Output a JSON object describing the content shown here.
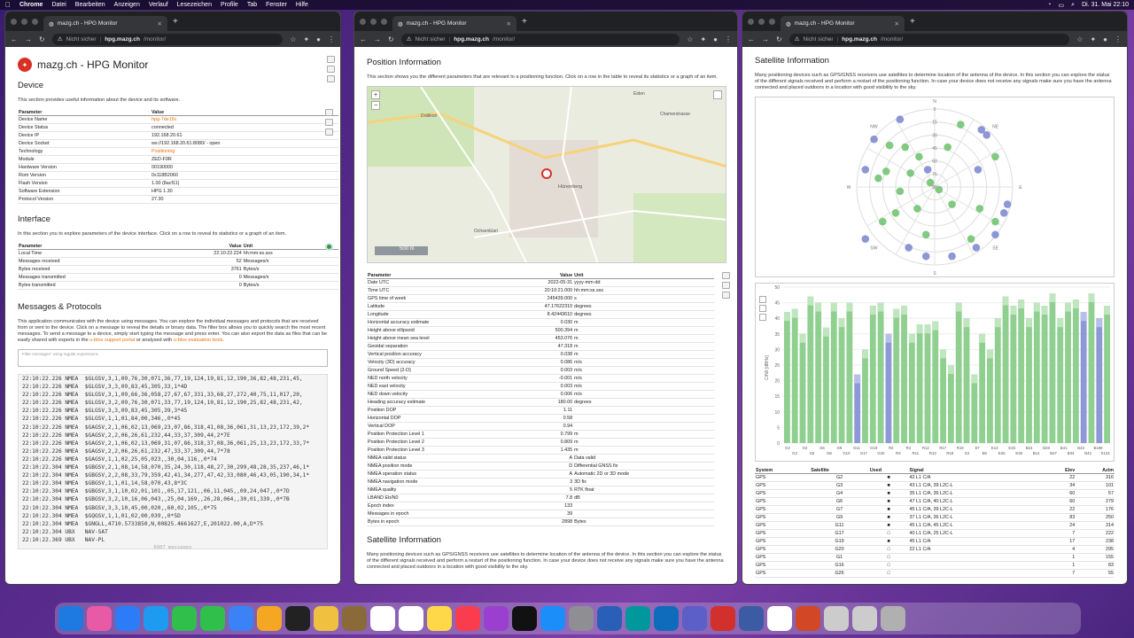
{
  "menubar": {
    "app": "Chrome",
    "items": [
      "Datei",
      "Bearbeiten",
      "Anzeigen",
      "Verlauf",
      "Lesezeichen",
      "Profile",
      "Tab",
      "Fenster",
      "Hilfe"
    ],
    "clock": "Di. 31. Mai  22:10"
  },
  "browser": {
    "tab_title": "mazg.ch - HPG Monitor",
    "not_secure": "Nicht sicher",
    "host": "hpg.mazg.ch",
    "path": "/monitor/"
  },
  "win1": {
    "title": "mazg.ch - HPG Monitor",
    "device_heading": "Device",
    "device_desc": "This section provides useful information about the device and its software.",
    "device_headers": [
      "Parameter",
      "Value"
    ],
    "device_rows": [
      [
        "Device Name",
        "hpg-7de16c"
      ],
      [
        "Device Status",
        "connected"
      ],
      [
        "Device IP",
        "192.168.20.61"
      ],
      [
        "Device Socket",
        "ws://192.168.20.61:8080/ - open"
      ],
      [
        "Technology",
        "Positioning"
      ],
      [
        "Module",
        "ZED-F9R"
      ],
      [
        "Hardware Version",
        "00190000"
      ],
      [
        "Rom Version",
        "0x118B2060"
      ],
      [
        "Flash Version",
        "1.00 (8acf11)"
      ],
      [
        "Software Extension",
        "HPG 1.30"
      ],
      [
        "Protocol Version",
        "27.30"
      ]
    ],
    "interface_heading": "Interface",
    "interface_desc": "In this section you to explore parameters of the device interface. Click on a row to reveal its statistics or a graph of an item.",
    "interface_headers": [
      "Parameter",
      "Value",
      "Unit"
    ],
    "interface_rows": [
      [
        "Local Time",
        "22:10:22.224",
        "hh:mm:ss.sss"
      ],
      [
        "Messages received",
        "52",
        "Messages/s"
      ],
      [
        "Bytes received",
        "3761",
        "Bytes/s"
      ],
      [
        "Messages transmitted",
        "0",
        "Messages/s"
      ],
      [
        "Bytes transmitted",
        "0",
        "Bytes/s"
      ]
    ],
    "messages_heading": "Messages & Protocols",
    "messages_desc": "This application communicates with the device using messages. You can explore the individual messages and protocols that are received from or sent to the device. Click on a message to reveal the details or binary data. The filter box allows you to quickly search the most recent messages. To send a message to a device, simply start typing the message and press enter. You can also export the data as files that can be easily shared with experts in the",
    "messages_link1": "u-blox support portal",
    "messages_mid": "or analysed with",
    "messages_link2": "u-blox evaluation tools",
    "filter_placeholder": "Filter messages\" using regular expressions",
    "console_lines": [
      "22:10:22.226 NMEA  $GLGSV,3,1,09,76,30,071,36,77,19,124,19,81,12,190,36,82,48,231,45,",
      "22:10:22.226 NMEA  $GLGSV,3,3,09,83,45,305,33,1*4D",
      "22:10:22.226 NMEA  $GLGSV,3,1,09,66,36,058,27,67,67,331,33,68,27,272,40,75,11,017,20,",
      "22:10:22.226 NMEA  $GLGSV,3,2,09,76,30,071,33,77,19,124,10,81,12,190,25,82,48,231,42,",
      "22:10:22.226 NMEA  $GLGSV,3,3,09,83,45,305,39,3*45",
      "22:10:22.226 NMEA  $GLGSV,1,1,01,84,00,346,,0*45",
      "22:10:22.226 NMEA  $GAGSV,2,1,06,02,13,069,23,07,86,318,41,08,36,061,31,13,23,172,39,2*",
      "22:10:22.226 NMEA  $GAGSV,2,2,06,26,61,232,44,33,37,309,44,2*7E",
      "22:10:22.226 NMEA  $GAGSV,2,1,06,02,13,069,31,07,86,318,37,08,36,061,25,13,23,172,33,7*",
      "22:10:22.226 NMEA  $GAGSV,2,2,06,26,61,232,47,33,37,309,44,7*78",
      "22:10:22.226 NMEA  $GAGSV,1,1,02,25,05,023,,30,04,116,,0*74",
      "22:10:22.304 NMEA  $GBGSV,2,1,08,14,58,070,35,24,30,118,48,27,30,299,48,28,35,237,46,1*",
      "22:10:22.304 NMEA  $GBGSV,2,2,08,33,79,359,42,41,34,277,47,42,33,080,46,43,05,190,34,1*",
      "22:10:22.304 NMEA  $GBGSV,1,1,01,14,58,070,43,8*3C",
      "22:10:22.304 NMEA  $GBGSV,3,1,10,02,01,101,,05,17,121,,06,11,045,,09,24,047,,0*7D",
      "22:10:22.304 NMEA  $GBGSV,3,2,10,16,06,043,,25,04,169,,26,28,064,,30,01,339,,0*7B",
      "22:10:22.304 NMEA  $GBGSV,3,3,10,45,00,020,,60,02,105,,0*75",
      "22:10:22.304 NMEA  $GQGSV,1,1,01,02,00,039,,0*5D",
      "22:10:22.304 NMEA  $GNGLL,4710.5733850,N,00825.4661627,E,201022.00,A,D*75",
      "22:10:22.304 UBX   NAV-SAT",
      "22:10:22.369 UBX   NAV-PL"
    ],
    "console_footer": "6907 messages"
  },
  "win2": {
    "position_heading": "Position Information",
    "position_desc": "This section shows you the different parameters that are relevant to a positioning function. Click on a row in the table to reveal its statistics or a graph of an item.",
    "map_labels": [
      "Hünenberg",
      "Drälikon",
      "Eiden",
      "Chamerstrasse",
      "Hofstetten",
      "Weiherstrasse",
      "Ochsenbüel",
      "Langrüti"
    ],
    "map_scale": "500 m",
    "pos_headers": [
      "Parameter",
      "Value",
      "Unit"
    ],
    "pos_rows": [
      [
        "Date UTC",
        "2022-05-31",
        "yyyy-mm-dd"
      ],
      [
        "Time UTC",
        "20:10:21.000",
        "hh:mm:ss.sss"
      ],
      [
        "GPS time of week",
        "245439.000",
        "s"
      ],
      [
        "Latitude",
        "47.17622310",
        "degrees"
      ],
      [
        "Longitude",
        "8.42443610",
        "degrees"
      ],
      [
        "Horizontal accuracy estimate",
        "0.030",
        "m"
      ],
      [
        "Height above ellipsoid",
        "500.394",
        "m"
      ],
      [
        "Height above mean sea level",
        "453.076",
        "m"
      ],
      [
        "Geoidal separation",
        "47.318",
        "m"
      ],
      [
        "Vertical position accuracy",
        "0.038",
        "m"
      ],
      [
        "Velocity (3D) accuracy",
        "0.086",
        "m/s"
      ],
      [
        "Ground Speed (2-D)",
        "0.003",
        "m/s"
      ],
      [
        "NED north velocity",
        "-0.001",
        "m/s"
      ],
      [
        "NED east velocity",
        "0.003",
        "m/s"
      ],
      [
        "NED down velocity",
        "0.006",
        "m/s"
      ],
      [
        "Heading accuracy estimate",
        "180.00",
        "degrees"
      ],
      [
        "Position DOP",
        "1.11",
        ""
      ],
      [
        "Horizontal DOP",
        "0.58",
        ""
      ],
      [
        "Vertical DOP",
        "0.94",
        ""
      ],
      [
        "Position Protection Level 1",
        "0.799",
        "m"
      ],
      [
        "Position Protection Level 2",
        "0.809",
        "m"
      ],
      [
        "Position Protection Level 3",
        "1.435",
        "m"
      ],
      [
        "NMEA valid status",
        "A",
        "Data valid"
      ],
      [
        "NMEA position mode",
        "D",
        "Differential GNSS fix"
      ],
      [
        "NMEA operation status",
        "A",
        "Automatic 2D or 3D mode"
      ],
      [
        "NMEA navigation mode",
        "3",
        "3D fix"
      ],
      [
        "NMEA quality",
        "5",
        "RTK float"
      ],
      [
        "LBAND Eb/N0",
        "7.8",
        "dB"
      ],
      [
        "Epoch index",
        "133",
        ""
      ],
      [
        "Messages in epoch",
        "39",
        ""
      ],
      [
        "Bytes in epoch",
        "2898",
        "Bytes"
      ]
    ],
    "sat_heading": "Satellite Information",
    "sat_desc": "Many positioning devices such as GPS/GNSS receivers use satellites to determine location of the antenna of the device. In this section you can explore the status of the different signals received and perform a restart of the positioning function. In case your device does not receive any signals make sure you have the antenna connected and placed outdoors in a location with good visibility to the sky."
  },
  "win3": {
    "sat_heading": "Satellite Information",
    "sat_desc": "Many positioning devices such as GPS/GNSS receivers use satellites to determine location of the antenna of the device. In this section you can explore the status of the different signals received and perform a restart of the positioning function. In case your device does not receive any signals make sure you have the antenna connected and placed outdoors in a location with good visibility to the sky.",
    "sky": {
      "directions": [
        "N",
        "NE",
        "E",
        "SE",
        "S",
        "SW",
        "W",
        "NW"
      ],
      "rings": [
        "0",
        "15",
        "30",
        "45",
        "60",
        "75",
        "90"
      ],
      "colors": {
        "used": "#6cbf6c",
        "tracked": "#7a85cf"
      }
    },
    "bars": {
      "ylabel": "C/N0 [dBHz]",
      "yticks": [
        "0",
        "5",
        "10",
        "15",
        "20",
        "25",
        "30",
        "35",
        "40",
        "45",
        "50"
      ],
      "xlabels_top": [
        "G2",
        "G4",
        "G6",
        "G9",
        "G11",
        "G19",
        "R2",
        "R4",
        "R12",
        "R17",
        "R19",
        "E7",
        "E13",
        "E33",
        "B24",
        "B28",
        "B41",
        "B43",
        "B196"
      ],
      "xlabels_bot": [
        "G3",
        "G5",
        "G8",
        "G10",
        "G17",
        "G20",
        "R3",
        "R11",
        "R13",
        "R18",
        "E2",
        "E8",
        "E26",
        "E36",
        "B14",
        "B27",
        "B33",
        "B42",
        "S123"
      ]
    },
    "sat_headers": [
      "System",
      "Satellite",
      "Used",
      "Signal",
      "Elev",
      "Azim"
    ],
    "sat_rows": [
      [
        "GPS",
        "G2",
        "■",
        "42 L1 C/A",
        "22",
        "316"
      ],
      [
        "GPS",
        "G3",
        "■",
        "43 L1 C/A, 39 L2C-L",
        "34",
        "101"
      ],
      [
        "GPS",
        "G4",
        "■",
        "35 L1 C/A, 36 L2C-L",
        "60",
        "57"
      ],
      [
        "GPS",
        "G6",
        "■",
        "47 L1 C/A, 40 L2C-L",
        "60",
        "279"
      ],
      [
        "GPS",
        "G7",
        "■",
        "45 L1 C/A, 39 L2C-L",
        "22",
        "176"
      ],
      [
        "GPS",
        "G9",
        "■",
        "37 L1 C/A, 36 L2C-L",
        "83",
        "250"
      ],
      [
        "GPS",
        "G11",
        "■",
        "45 L1 C/A, 45 L2C-L",
        "24",
        "314"
      ],
      [
        "GPS",
        "G17",
        "□",
        "40 L1 C/A, 25 L2C-L",
        "7",
        "222"
      ],
      [
        "GPS",
        "G19",
        "■",
        "45 L1 C/A",
        "17",
        "238"
      ],
      [
        "GPS",
        "G20",
        "□",
        "22 L1 C/A",
        "4",
        "295"
      ],
      [
        "GPS",
        "G1",
        "□",
        "",
        "1",
        "155"
      ],
      [
        "GPS",
        "G16",
        "□",
        "",
        "1",
        "83"
      ],
      [
        "GPS",
        "G26",
        "□",
        "",
        "7",
        "55"
      ]
    ]
  }
}
